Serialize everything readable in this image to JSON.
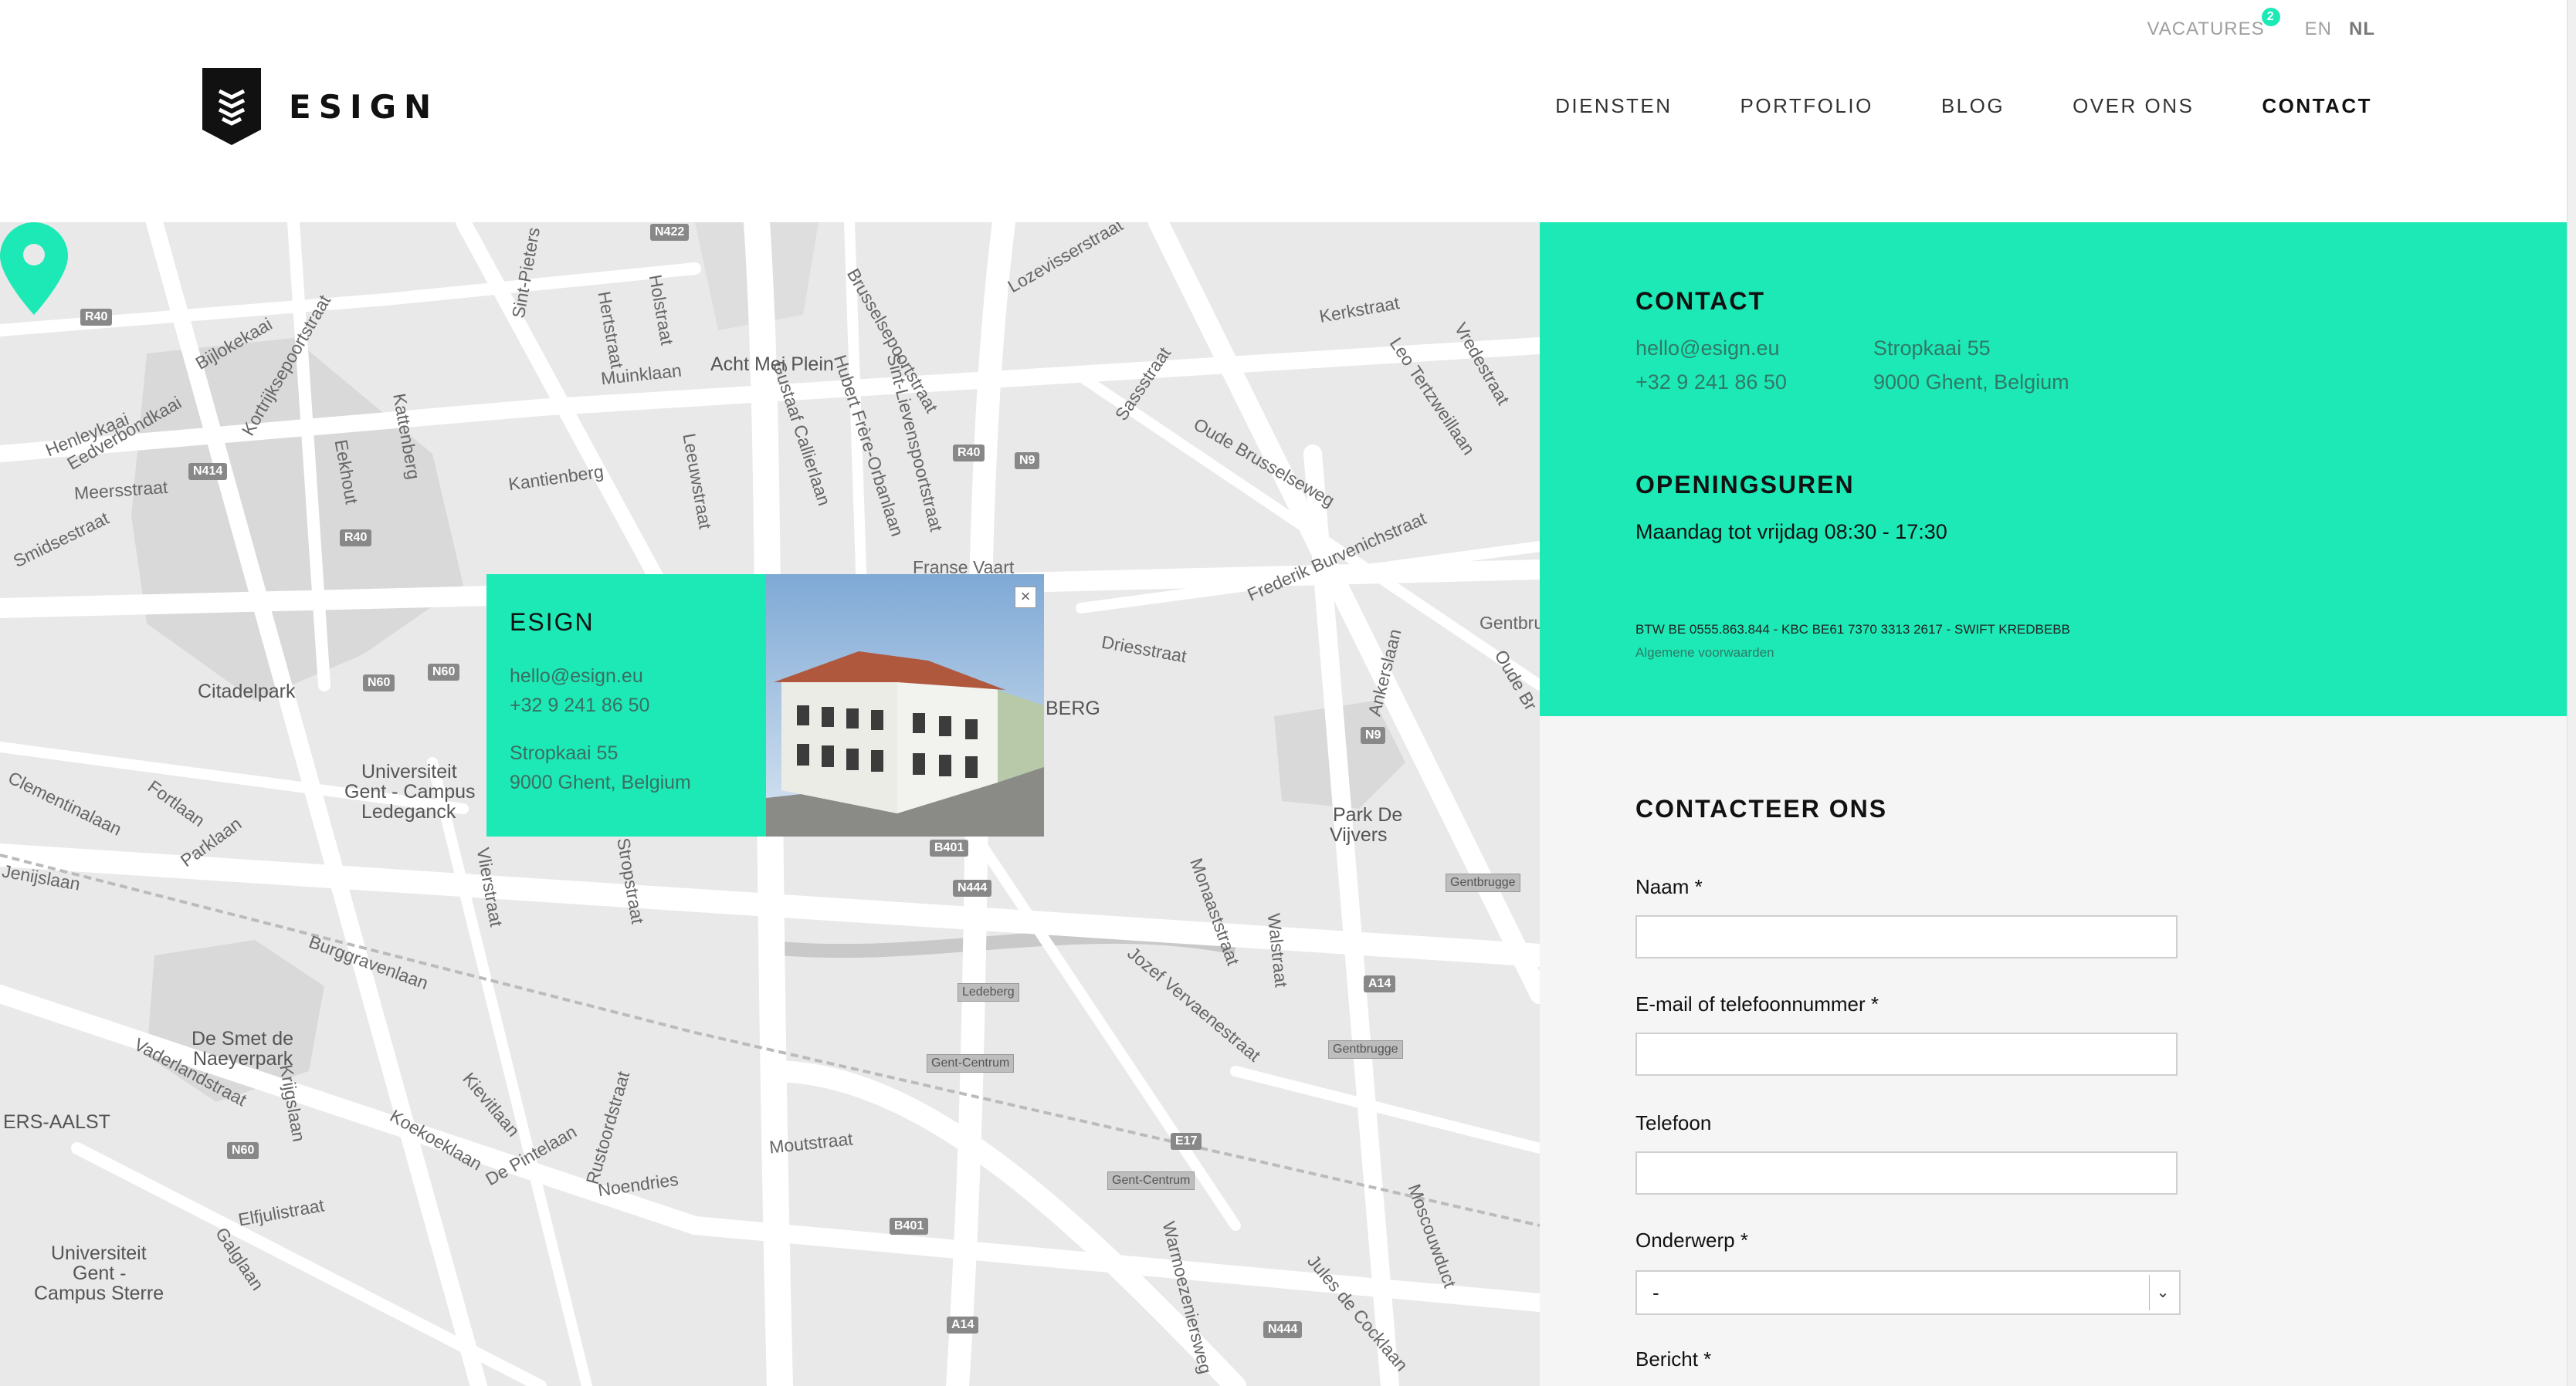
{
  "brand": {
    "name": "ESIGN"
  },
  "top_links": {
    "vacatures": "VACATURES",
    "vacatures_badge": "2",
    "lang_en": "EN",
    "lang_nl": "NL"
  },
  "nav": {
    "items": [
      {
        "label": "DIENSTEN"
      },
      {
        "label": "PORTFOLIO"
      },
      {
        "label": "BLOG"
      },
      {
        "label": "OVER ONS"
      },
      {
        "label": "CONTACT"
      }
    ]
  },
  "map": {
    "labels": [
      "Acht Mei Plein",
      "Citadelpark",
      "Universiteit",
      "Gent - Campus",
      "Ledeganck",
      "Park De",
      "Vijvers",
      "De Smet de",
      "Naeyerpark",
      "Universiteit",
      "Gent -",
      "Campus Sterre",
      "Franse Vaart",
      "Kortrijksepoortstraat",
      "Bijlokekaai",
      "Henleykaai",
      "Eedverbondkaai",
      "Meersstraat",
      "Smidsestraat",
      "Kattenberg",
      "Eekhout",
      "Kantienberg",
      "Muinklaan",
      "Leeuwstraat",
      "Gustaaf Callierlaan",
      "Hubert Frère-Orbanlaan",
      "Brusselsepoortstraat",
      "Sint-Lievenspoortstraat",
      "Sassstraat",
      "Oude Brusselseweg",
      "Frederik Burvenichstraat",
      "Driesstraat",
      "Kerkstraat",
      "Lozevisserstraat",
      "Burggravenlaan",
      "Krijgslaan",
      "Fortlaan",
      "Parklaan",
      "Vaderlandstraat",
      "Koekoeklaan",
      "Kievitlaan",
      "De Pintelaan",
      "Rustoordstraat",
      "Noendries",
      "Moutstraat",
      "Elfjulistraat",
      "Galglaan",
      "Jozef Vervaenestraat",
      "Monaaststraat",
      "Walstraat",
      "Ankerslaan",
      "Moscouwduct",
      "Jules de Cocklaan",
      "Warmoezeniersweg",
      "ERS-AALST",
      "BERG",
      "Vlierstraat",
      "Stropstraat",
      "Clementinalaan",
      "Jenijslaan",
      "Hertstraat",
      "Holstraat",
      "Sint-Pieters",
      "Leo Tertzweillaan",
      "Vredestraat",
      "Oude Br",
      "Gentbru"
    ],
    "shields": [
      "N422",
      "R40",
      "N414",
      "R40",
      "N60",
      "N60",
      "R40",
      "N9",
      "N9",
      "B401",
      "N444",
      "A14",
      "E17",
      "B401",
      "A14",
      "N444",
      "N60"
    ],
    "stops": [
      "Ledeberg",
      "Gent-Centrum",
      "Gent-Centrum",
      "Gentbrugge",
      "Gentbrugge"
    ],
    "popup": {
      "title": "ESIGN",
      "email": "hello@esign.eu",
      "phone": "+32 9 241 86 50",
      "street": "Stropkaai 55",
      "city": "9000 Ghent, Belgium",
      "close": "×"
    }
  },
  "contact": {
    "title": "CONTACT",
    "email": "hello@esign.eu",
    "phone": "+32 9 241 86 50",
    "street": "Stropkaai 55",
    "city": "9000 Ghent, Belgium",
    "hours_title": "OPENINGSUREN",
    "hours": "Maandag tot vrijdag 08:30 - 17:30",
    "legal": "BTW BE 0555.863.844 - KBC BE61 7370 3313 2617 - SWIFT KREDBEBB",
    "terms": "Algemene voorwaarden"
  },
  "form": {
    "title": "CONTACTEER ONS",
    "name_label": "Naam *",
    "email_label": "E-mail of telefoonnummer *",
    "phone_label": "Telefoon",
    "subject_label": "Onderwerp *",
    "subject_value": "-",
    "message_label": "Bericht *"
  },
  "colors": {
    "accent": "#1de9b6",
    "map_bg": "#e9e9e9",
    "road": "#ffffff"
  }
}
